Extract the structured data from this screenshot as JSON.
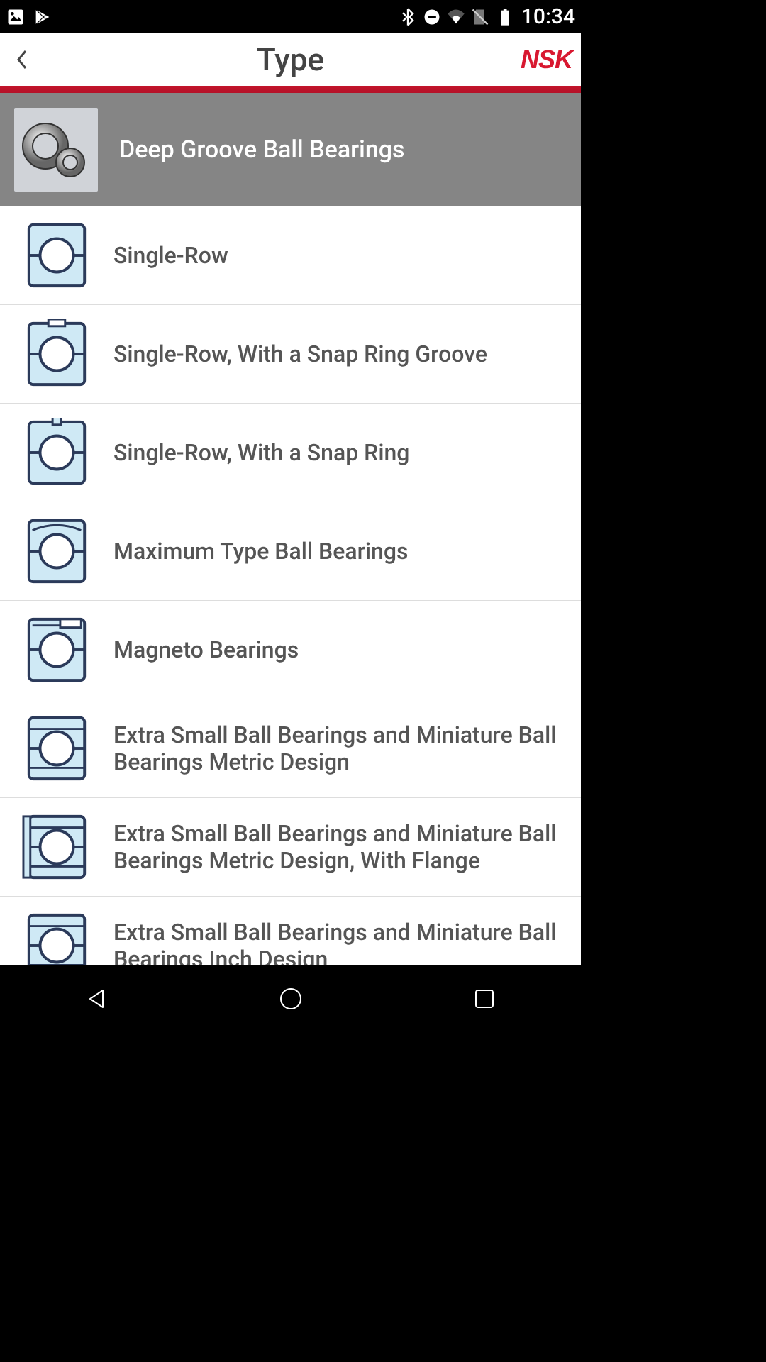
{
  "statusbar": {
    "time": "10:34"
  },
  "header": {
    "title": "Type",
    "brand": "NSK"
  },
  "category": {
    "title": "Deep Groove Ball Bearings"
  },
  "items": [
    {
      "label": "Single-Row",
      "icon": "plain"
    },
    {
      "label": "Single-Row, With a Snap Ring Groove",
      "icon": "groove"
    },
    {
      "label": "Single-Row, With a Snap Ring",
      "icon": "snapring"
    },
    {
      "label": "Maximum Type Ball Bearings",
      "icon": "max"
    },
    {
      "label": "Magneto Bearings",
      "icon": "magneto"
    },
    {
      "label": "Extra Small Ball Bearings and Miniature Ball Bearings Metric Design",
      "icon": "mini"
    },
    {
      "label": "Extra Small Ball Bearings and Miniature Ball Bearings Metric Design, With Flange",
      "icon": "mini-flange"
    },
    {
      "label": "Extra Small Ball Bearings and Miniature Ball Bearings Inch Design",
      "icon": "mini-inch"
    }
  ]
}
